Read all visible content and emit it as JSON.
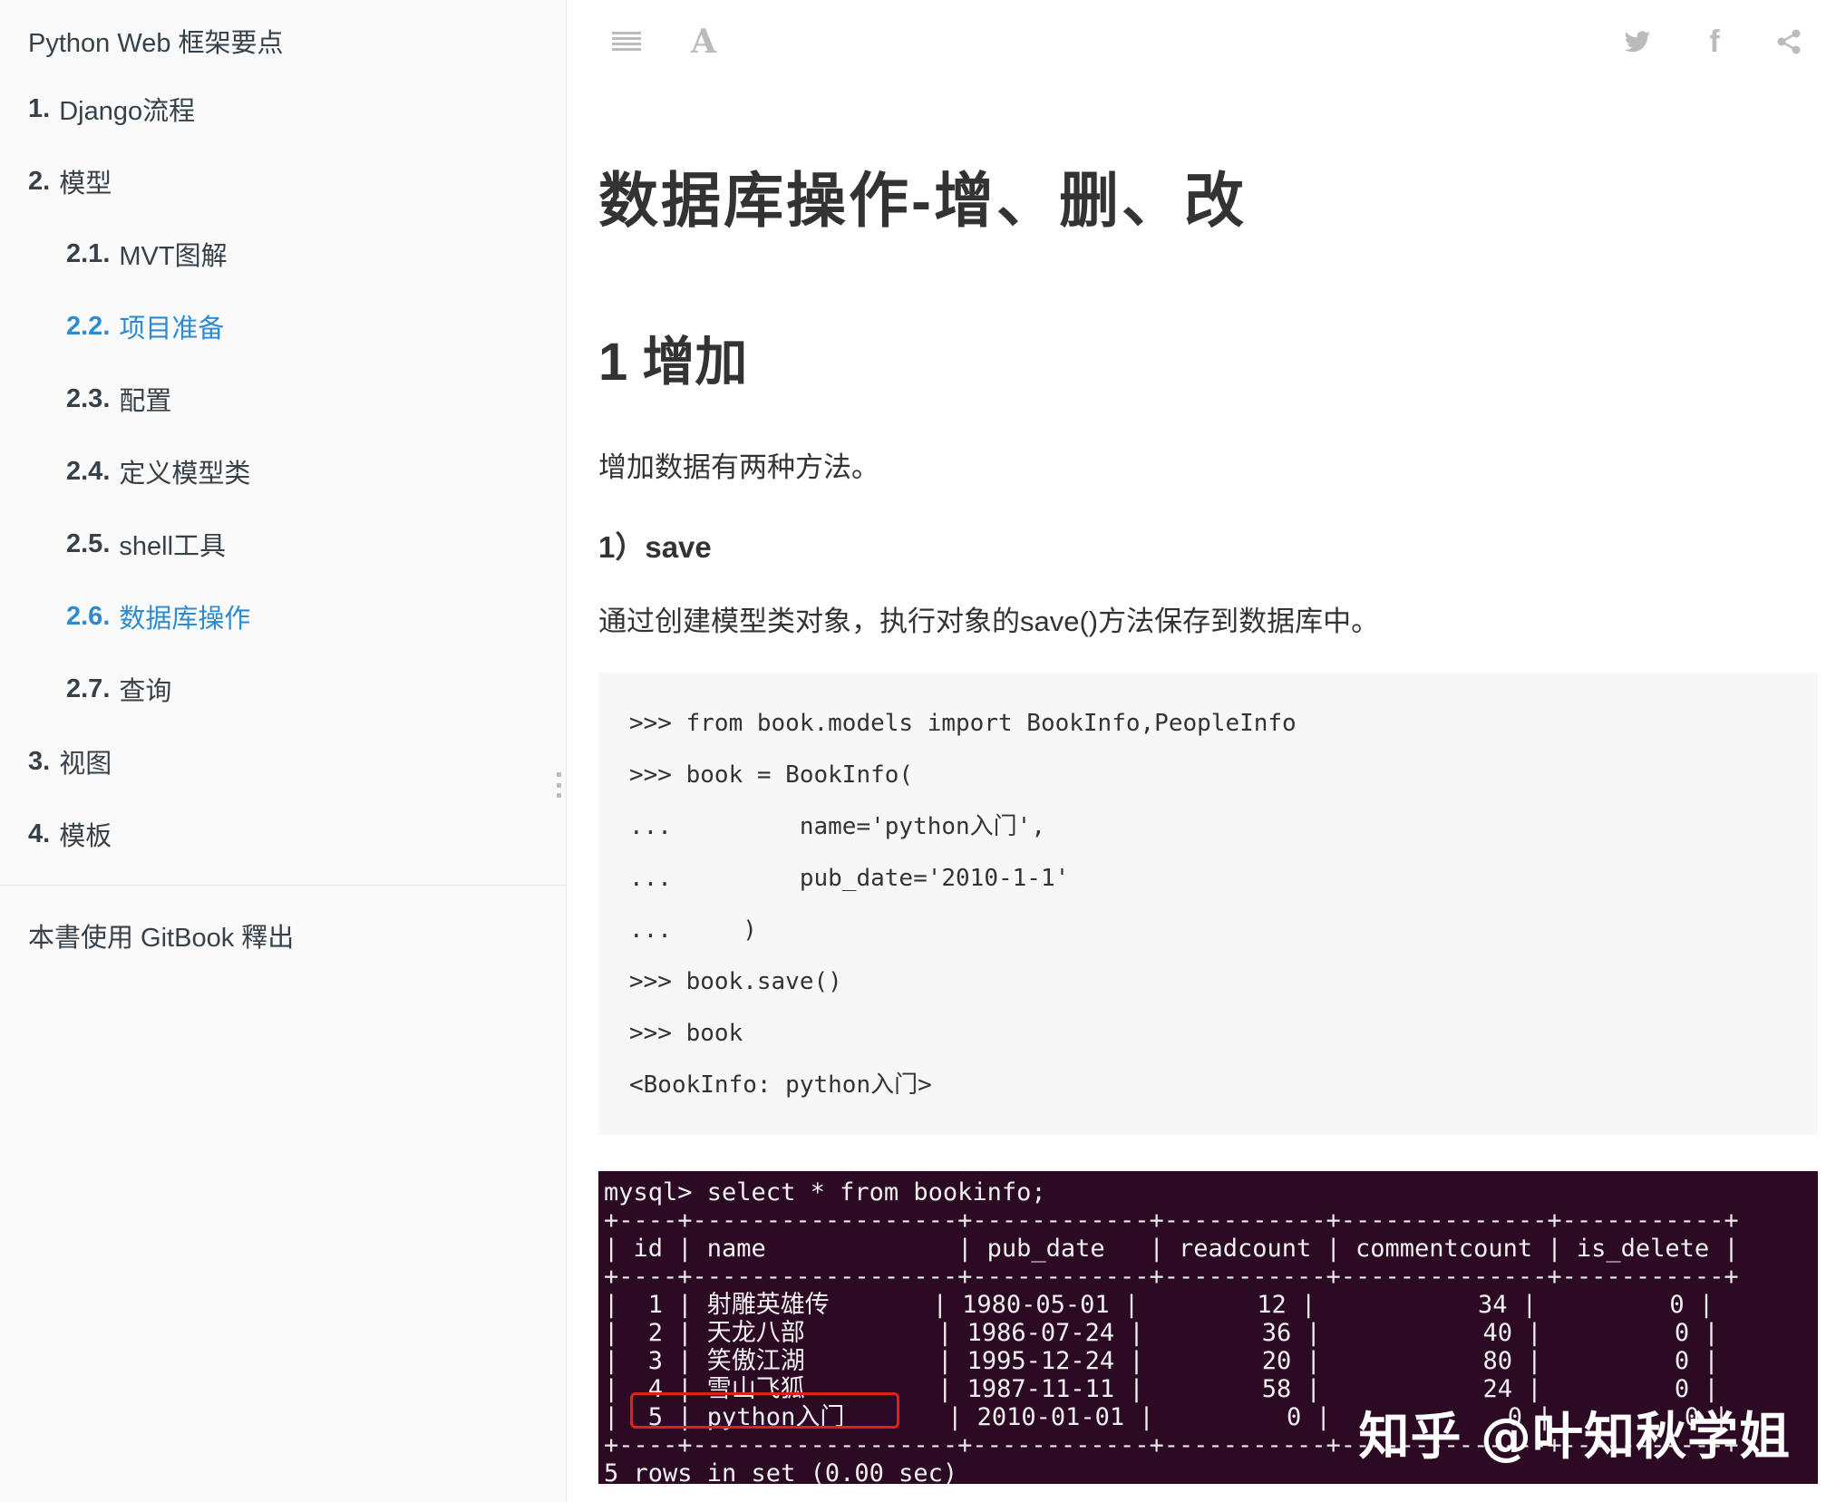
{
  "sidebar": {
    "header": "Python Web 框架要点",
    "items": [
      {
        "num": "1.",
        "label": "Django流程",
        "level": 1,
        "active": false
      },
      {
        "num": "2.",
        "label": "模型",
        "level": 1,
        "active": false
      },
      {
        "num": "2.1.",
        "label": "MVT图解",
        "level": 2,
        "active": false
      },
      {
        "num": "2.2.",
        "label": "项目准备",
        "level": 2,
        "active": true
      },
      {
        "num": "2.3.",
        "label": "配置",
        "level": 2,
        "active": false
      },
      {
        "num": "2.4.",
        "label": "定义模型类",
        "level": 2,
        "active": false
      },
      {
        "num": "2.5.",
        "label": "shell工具",
        "level": 2,
        "active": false
      },
      {
        "num": "2.6.",
        "label": "数据库操作",
        "level": 2,
        "active": true
      },
      {
        "num": "2.7.",
        "label": "查询",
        "level": 2,
        "active": false
      },
      {
        "num": "3.",
        "label": "视图",
        "level": 1,
        "active": false
      },
      {
        "num": "4.",
        "label": "模板",
        "level": 1,
        "active": false
      }
    ],
    "footer": "本書使用 GitBook 釋出"
  },
  "toolbar": {
    "font_glyph": "A",
    "facebook_glyph": "f",
    "icons": [
      "menu-icon",
      "font-settings-icon",
      "twitter-icon",
      "facebook-icon",
      "share-icon"
    ]
  },
  "content": {
    "title": "数据库操作-增、删、改",
    "section": "1 增加",
    "intro": "增加数据有两种方法。",
    "sub": "1）save",
    "desc": "通过创建模型类对象，执行对象的save()方法保存到数据库中。",
    "code": [
      ">>> from book.models import BookInfo,PeopleInfo",
      ">>> book = BookInfo(",
      "...         name='python入门',",
      "...         pub_date='2010-1-1'",
      "...     )",
      ">>> book.save()",
      ">>> book",
      "<BookInfo: python入门>"
    ]
  },
  "terminal": {
    "lines": [
      "mysql> select * from bookinfo;",
      "+----+------------------+------------+-----------+--------------+-----------+",
      "| id | name             | pub_date   | readcount | commentcount | is_delete |",
      "+----+------------------+------------+-----------+--------------+-----------+",
      "|  1 | 射雕英雄传       | 1980-05-01 |        12 |           34 |         0 |",
      "|  2 | 天龙八部         | 1986-07-24 |        36 |           40 |         0 |",
      "|  3 | 笑傲江湖         | 1995-12-24 |        20 |           80 |         0 |",
      "|  4 | 雪山飞狐         | 1987-11-11 |        58 |           24 |         0 |",
      "|  5 | python入门       | 2010-01-01 |         0 |            0 |         0 |",
      "+----+------------------+------------+-----------+--------------+-----------+",
      "5 rows in set (0.00 sec)"
    ],
    "watermark": "知乎 @叶知秋学姐"
  },
  "colors": {
    "active": "#2e8bd0",
    "sidebar_bg": "#fafafa",
    "code_bg": "#f7f7f7",
    "terminal_bg": "#2c0a24",
    "highlight": "#e0201a"
  }
}
